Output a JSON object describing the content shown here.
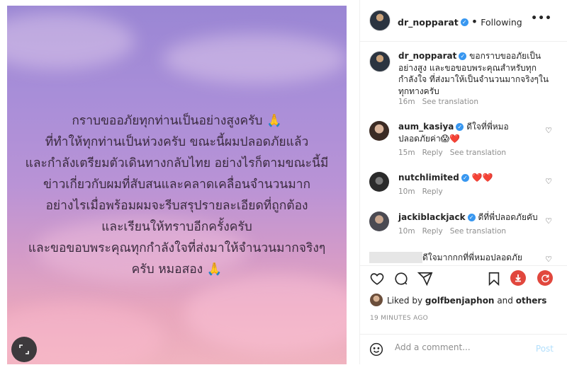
{
  "post": {
    "caption_lines": [
      "กราบขออภัยทุกท่านเป็นอย่างสูงครับ 🙏",
      "ที่ทำให้ทุกท่านเป็นห่วงครับ ขณะนี้ผมปลอดภัยแล้ว",
      "และกำลังเตรียมตัวเดินทางกลับไทย อย่างไรก็ตามขณะนี้มี",
      "ข่าวเกี่ยวกับผมที่สับสนและคลาดเคลื่อนจำนวนมาก",
      "อย่างไรเมื่อพร้อมผมจะรีบสรุปรายละเอียดที่ถูกต้อง",
      "และเรียนให้ทราบอีกครั้งครับ",
      "และขอขอบพระคุณทุกกำลังใจที่ส่งมาให้จำนวนมากจริงๆ",
      "ครับ หมอสอง 🙏"
    ]
  },
  "header": {
    "username": "dr_nopparat",
    "separator": "•",
    "follow_label": "Following",
    "more": "•••"
  },
  "comments": [
    {
      "username": "dr_nopparat",
      "verified": true,
      "text": "ขอกราบขออภัยเป็นอย่างสูง และขอขอบพระคุณสำหรับทุกกำลังใจ ที่ส่งมาให้เป็นจำนวนมากจริงๆในทุกทางครับ",
      "time": "16m",
      "see_translation": "See translation"
    },
    {
      "username": "aum_kasiya",
      "verified": true,
      "text": "ดีใจที่พี่หมอปลอดภัยค่า😱❤️",
      "time": "15m",
      "reply": "Reply",
      "see_translation": "See translation"
    },
    {
      "username": "nutchlimited",
      "verified": true,
      "text": "❤️❤️",
      "time": "10m",
      "reply": "Reply"
    },
    {
      "username": "jackiblackjack",
      "verified": true,
      "text": "ดีที่พี่ปลอดภัยคับ",
      "time": "10m",
      "reply": "Reply",
      "see_translation": "See translation"
    },
    {
      "text": "ดีใจมากกกที่พี่หมอปลอดภัย"
    }
  ],
  "likes": {
    "prefix": "Liked by",
    "user": "golfbenjaphon",
    "and": "and",
    "others": "others"
  },
  "timestamp": "19 MINUTES AGO",
  "add_comment": {
    "placeholder": "Add a comment...",
    "post_label": "Post"
  },
  "colors": {
    "verified": "#3897f0",
    "heart": "#ed4956",
    "save_badge": "#e1473d",
    "post_disabled": "#b2dffc"
  },
  "icons": [
    "heart-icon",
    "comment-icon",
    "share-icon",
    "bookmark-icon",
    "download-icon",
    "refresh-icon",
    "emoji-icon",
    "expand-icon"
  ]
}
